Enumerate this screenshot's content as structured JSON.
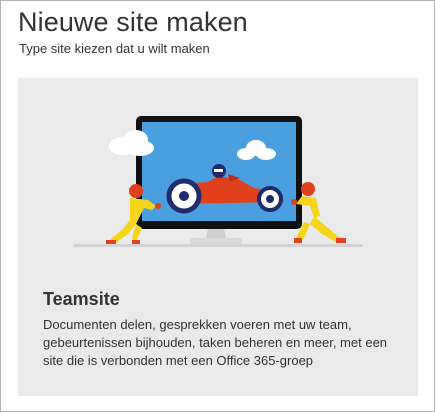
{
  "dialog": {
    "title": "Nieuwe site maken",
    "subtitle": "Type site kiezen dat u wilt maken"
  },
  "site_option": {
    "title": "Teamsite",
    "description": "Documenten delen, gesprekken voeren met uw team, gebeurtenissen bijhouden, taken beheren en meer, met een site die is verbonden met een Office 365-groep",
    "illustration": "monitor-race-car-illustration"
  },
  "colors": {
    "screen_blue": "#4a9fe0",
    "car_red": "#e0401c",
    "figure_yellow": "#f5d51a",
    "card_background": "#eaeaea"
  }
}
